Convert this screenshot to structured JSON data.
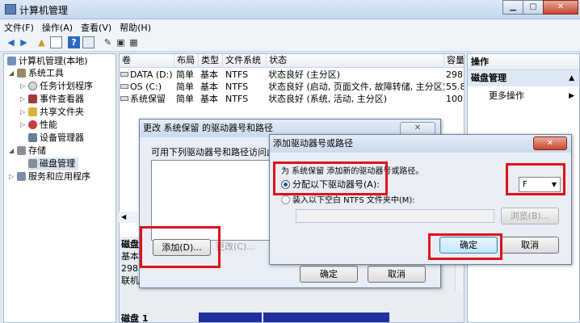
{
  "window": {
    "title": "计算机管理",
    "btn_min": "▁",
    "btn_max": "▢",
    "btn_close": "✕"
  },
  "menu": [
    "文件(F)",
    "操作(A)",
    "查看(V)",
    "帮助(H)"
  ],
  "toolbar_icons": [
    "back-arrow-icon",
    "forward-arrow-icon",
    "up-folder-icon",
    "show-tree-icon",
    "help-icon",
    "properties-icon",
    "refresh-icon",
    "export-icon",
    "view-icon"
  ],
  "tree": {
    "root": "计算机管理(本地)",
    "system_tools": "系统工具",
    "task_scheduler": "任务计划程序",
    "event_viewer": "事件查看器",
    "shared_folders": "共享文件夹",
    "performance": "性能",
    "device_manager": "设备管理器",
    "storage": "存储",
    "disk_management": "磁盘管理",
    "services": "服务和应用程序"
  },
  "volumes": {
    "headers": [
      "卷",
      "布局",
      "类型",
      "文件系统",
      "状态",
      "容量"
    ],
    "rows": [
      [
        "DATA (D:)",
        "简单",
        "基本",
        "NTFS",
        "状态良好 (主分区)",
        "298."
      ],
      [
        "OS (C:)",
        "简单",
        "基本",
        "NTFS",
        "状态良好 (启动, 页面文件, 故障转储, 主分区)",
        "55.8"
      ],
      [
        "系统保留",
        "简单",
        "基本",
        "NTFS",
        "状态良好 (系统, 活动, 主分区)",
        "100"
      ]
    ]
  },
  "lower": {
    "disk0_name": "磁盘",
    "disk0_type": "基本",
    "disk0_size": "298",
    "disk0_status": "联机",
    "disk1_name": "磁盘 1"
  },
  "actions": {
    "header": "操作",
    "section": "磁盘管理",
    "more": "更多操作"
  },
  "change_dialog": {
    "title": "更改 系统保留 的驱动器号和路径",
    "label": "可用下列驱动器号和路径访问此卷",
    "add": "添加(D)...",
    "change": "更改(C)...",
    "ok": "确定",
    "cancel": "取消"
  },
  "add_dialog": {
    "title": "添加驱动器号或路径",
    "intro": "为 系统保留 添加新的驱动器号或路径。",
    "radio_assign": "分配以下驱动器号(A):",
    "radio_mount": "装入以下空白 NTFS 文件夹中(M):",
    "browse": "浏览(B)...",
    "drive_letter": "F",
    "ok": "确定",
    "cancel": "取消"
  },
  "colors": {
    "highlight": "#e0101a",
    "disk_bar": "#1f2fa0"
  }
}
